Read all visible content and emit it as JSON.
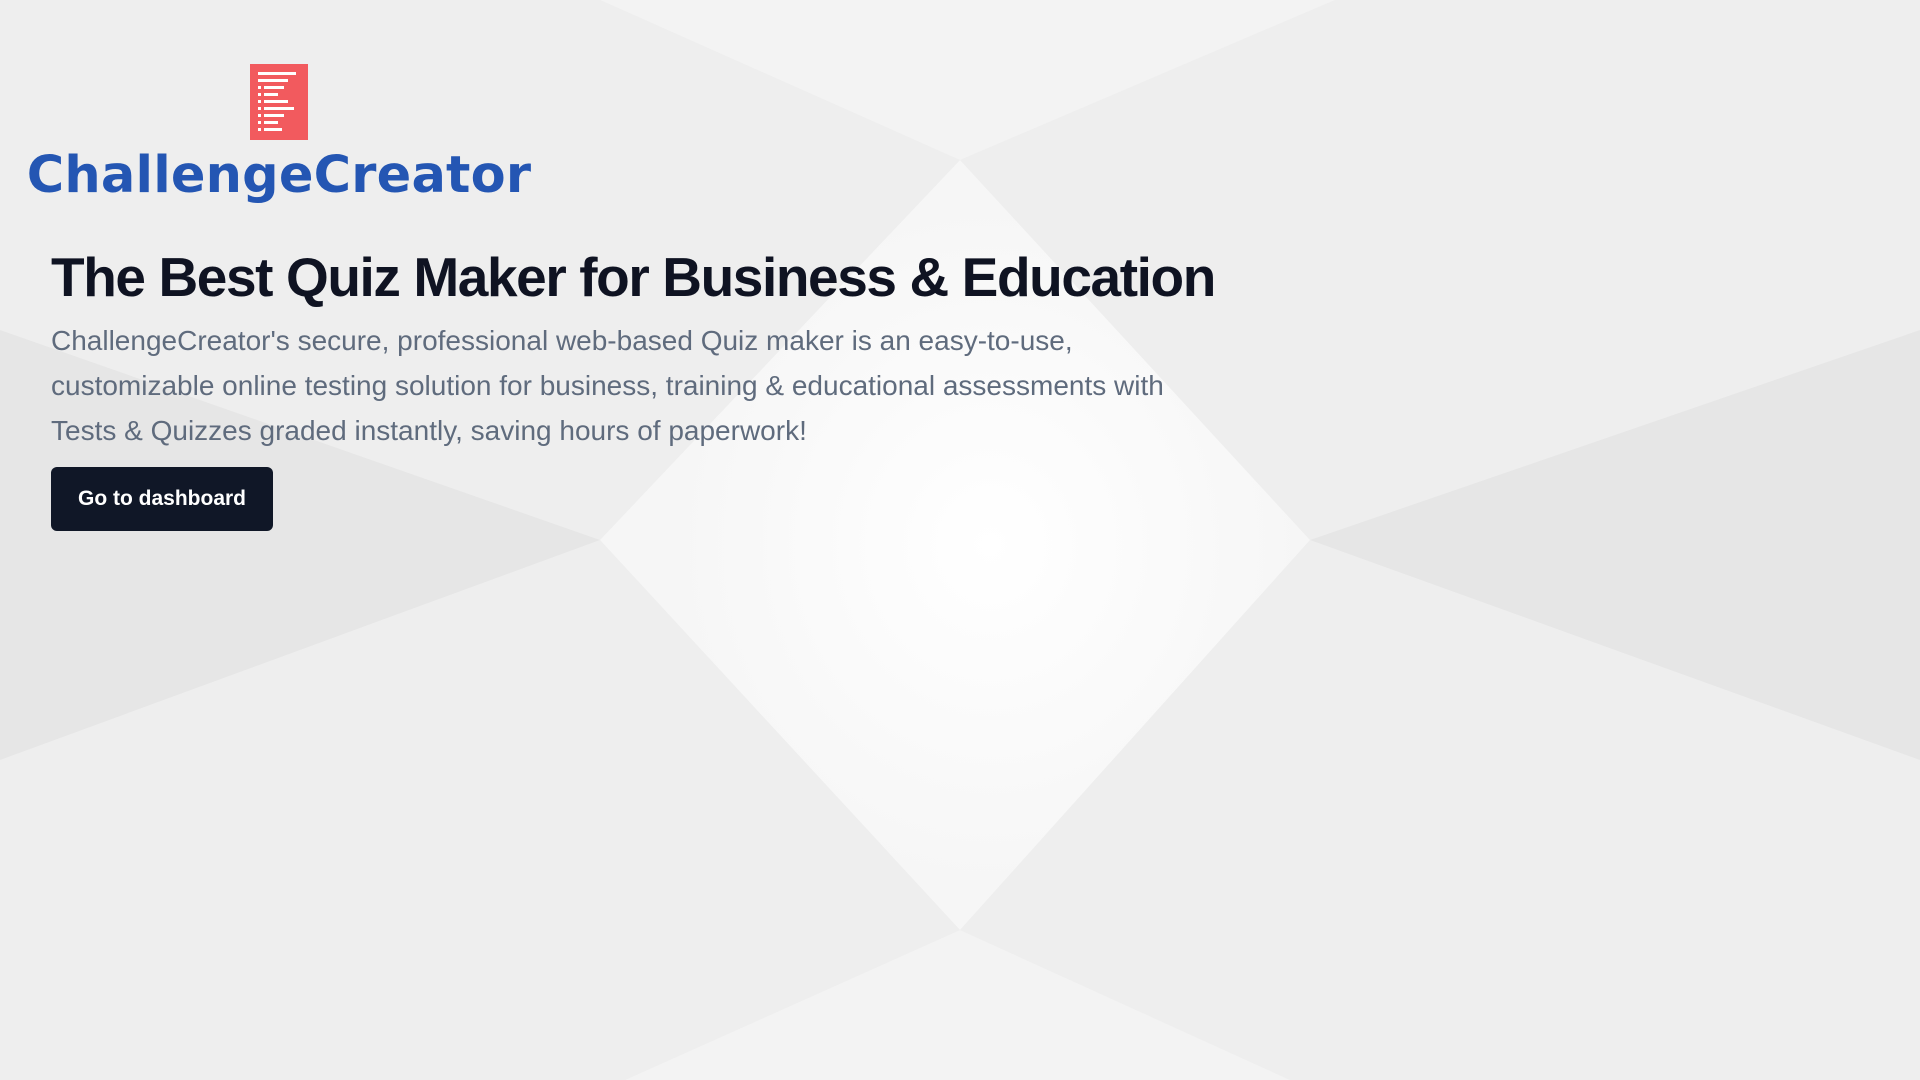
{
  "brand": {
    "logo_icon": "document-list-icon",
    "name": "ChallengeCreator"
  },
  "hero": {
    "headline": "The Best Quiz Maker for Business & Education",
    "description": "ChallengeCreator's secure, professional web-based Quiz maker is an easy-to-use, customizable online testing solution for business, training & educational assessments with Tests & Quizzes graded instantly, saving hours of paperwork!",
    "cta_label": "Go to dashboard"
  },
  "colors": {
    "brand_blue": "#2456b3",
    "logo_red": "#f25a5e",
    "headline": "#0f1322",
    "body_text": "#5f6b7d",
    "button_bg": "#101727",
    "button_text": "#ffffff"
  }
}
